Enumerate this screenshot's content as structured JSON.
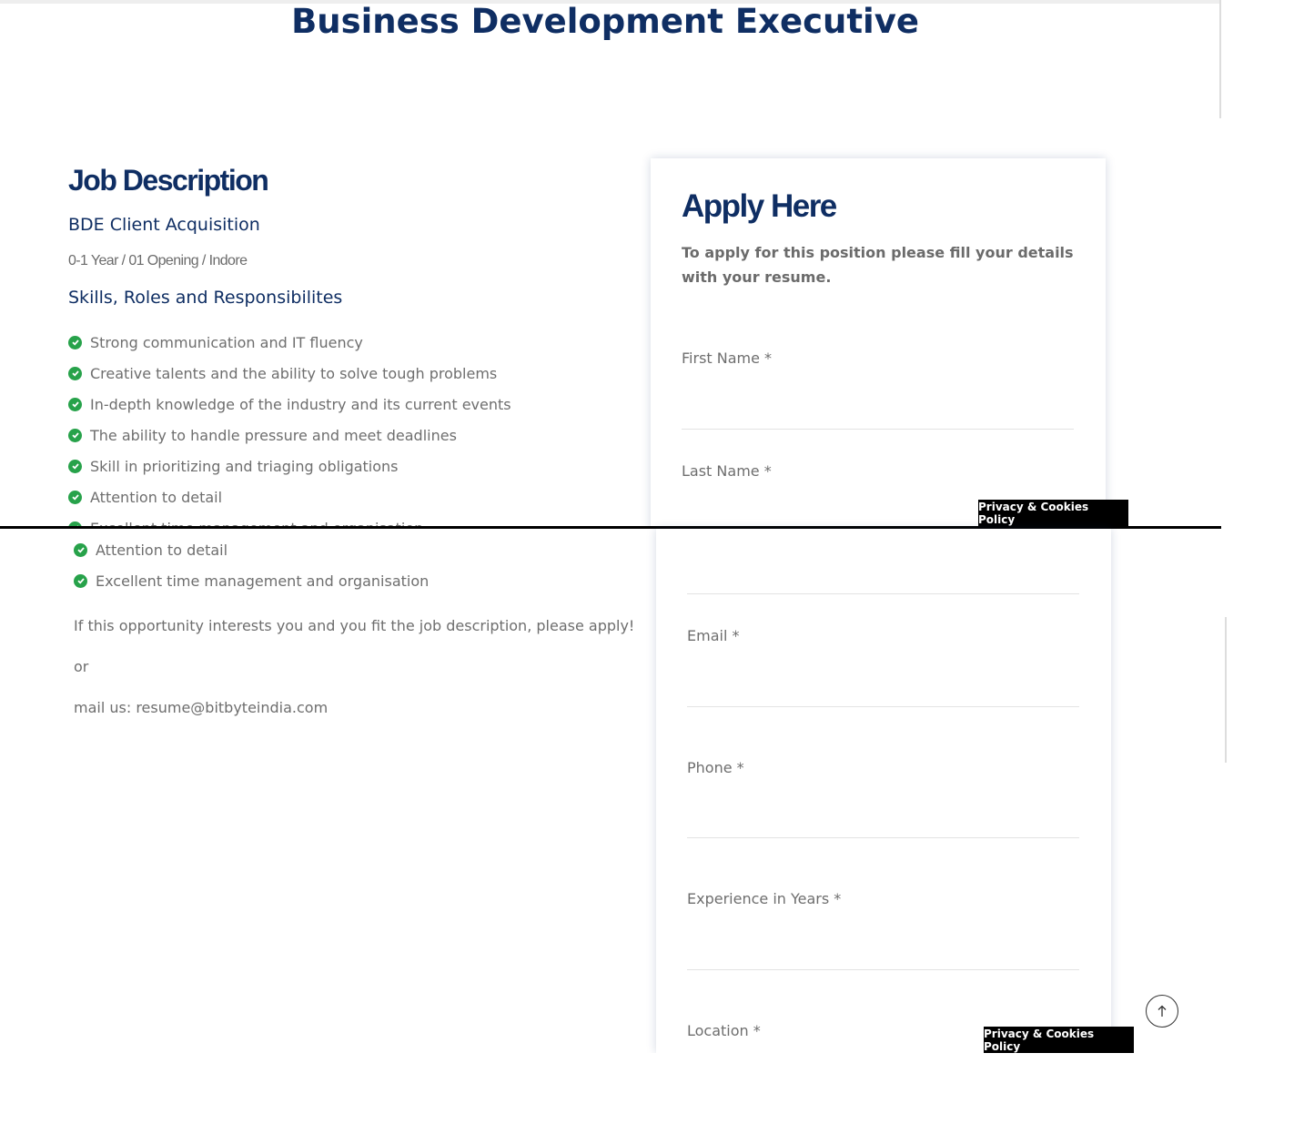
{
  "page_title": "Business Development Executive",
  "job": {
    "heading": "Job Description",
    "subtitle": "BDE Client Acquisition",
    "meta": "0-1 Year / 01 Opening / Indore",
    "skills_heading": "Skills, Roles and Responsibilites",
    "skills": [
      "Strong communication and IT fluency",
      "Creative talents and the ability to solve tough problems",
      "In-depth knowledge of the industry and its current events",
      "The ability to handle pressure and meet deadlines",
      "Skill in prioritizing and triaging obligations",
      "Attention to detail",
      "Excellent time management and organisation"
    ],
    "apply_prompt": "If this opportunity interests you and you fit the job description, please apply!",
    "or_text": "or",
    "mail_text": "mail us: resume@bitbyteindia.com"
  },
  "apply": {
    "heading": "Apply Here",
    "intro": "To apply for this position please fill your details with your resume.",
    "fields": {
      "first_name": "First Name *",
      "last_name": "Last Name *",
      "email": "Email *",
      "phone": "Phone *",
      "experience": "Experience in Years *",
      "location": "Location *"
    }
  },
  "cookie_button": "Privacy & Cookies Policy",
  "icons": {
    "check": "check-circle-icon",
    "scroll_top": "arrow-up-icon"
  },
  "colors": {
    "heading": "#0f2e63",
    "check": "#27a24a",
    "text": "#6e6e6e"
  }
}
